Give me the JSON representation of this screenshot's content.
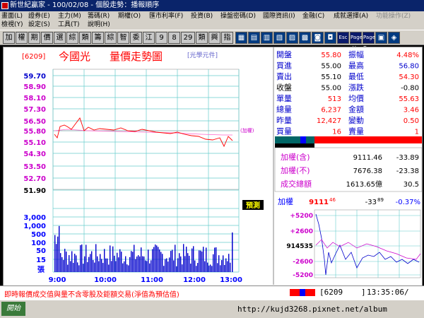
{
  "window": {
    "title": "新世紀贏家 - 100/02/08 - 個股走勢：播報順序"
  },
  "menu": {
    "row1": [
      "畫面(L)",
      "證券(E)",
      "主力(M)",
      "籌碼(R)",
      "期權(O)",
      "匯市利率(F)",
      "投資(B)",
      "操盤密碼(D)",
      "國際資訊(I)",
      "金融(C)",
      "成就選擇(A)",
      "功能操作(Z)"
    ],
    "row2": [
      "檢視(Y)",
      "設定(S)",
      "工具(T)",
      "說明(H)"
    ]
  },
  "toolbar": [
    "加",
    "權",
    "期",
    "價",
    "選",
    "綜",
    "類",
    "籌",
    "綜",
    "智",
    "委",
    "江",
    "9",
    "8",
    "29",
    "類",
    "興",
    "指"
  ],
  "toolbar_icons": [
    "Esc",
    "Page Up",
    "Page Down"
  ],
  "stock": {
    "code": "[6209]",
    "name": "今國光",
    "title": "量價走勢圖",
    "unit": "[光學元件]",
    "ref_label": "(加權)",
    "predicted_label": "預測"
  },
  "price_axis": [
    "59.70",
    "58.90",
    "58.10",
    "57.30",
    "56.50",
    "55.80",
    "55.10",
    "54.30",
    "53.50",
    "52.70",
    "51.90"
  ],
  "volume_axis": [
    "3,000",
    "1,000",
    "500",
    "100",
    "50",
    "15",
    "張"
  ],
  "time_axis": [
    "9:00",
    "10:00",
    "11:00",
    "12:00",
    "13:00"
  ],
  "quote": [
    {
      "l1": "開盤",
      "v1": "55.80",
      "l2": "振幅",
      "v2": "4.48%"
    },
    {
      "l1": "買進",
      "v1": "55.00",
      "l2": "最高",
      "v2": "56.80"
    },
    {
      "l1": "賣出",
      "v1": "55.10",
      "l2": "最低",
      "v2": "54.30"
    },
    {
      "l1": "收盤",
      "v1": "55.00",
      "l2": "漲跌",
      "v2": "-0.80"
    },
    {
      "l1": "單量",
      "v1": "513",
      "l2": "均價",
      "v2": "55.63"
    },
    {
      "l1": "總量",
      "v1": "6,237",
      "l2": "金額",
      "v2": "3.46"
    },
    {
      "l1": "昨量",
      "v1": "12,427",
      "l2": "變動",
      "v2": "0.50"
    },
    {
      "l1": "買量",
      "v1": "16",
      "l2": "賣量",
      "v2": "1"
    }
  ],
  "index": [
    {
      "label": "加權(含)",
      "value": "9111.46",
      "change": "-33.89"
    },
    {
      "label": "加權(不)",
      "value": "7676.38",
      "change": "-23.38"
    },
    {
      "label": "成交總額",
      "value": "1613.65億",
      "change": "30.5"
    }
  ],
  "mini": {
    "label": "加權",
    "value_int": "9111",
    "value_dec": "46",
    "change_int": "-33",
    "change_dec": "89",
    "pct": "-0.37%",
    "axis": [
      "+5200",
      "+2600",
      "914535",
      "-2600",
      "-5200"
    ]
  },
  "status": {
    "message": "即時報價成交值與量不含零股及鉅額交易(淨值為預估值)",
    "code_display": "[6209",
    "code_close": "]",
    "time": "13:35:06/"
  },
  "taskbar": {
    "start_label": "開始",
    "watermark": "http://kujd3268.pixnet.net/album"
  },
  "colors": {
    "accent_red": "#ff0000",
    "navy": "#0a246a",
    "magenta": "#cc00cc",
    "blue": "#0000ff",
    "grid_cyan": "#66cccc"
  }
}
